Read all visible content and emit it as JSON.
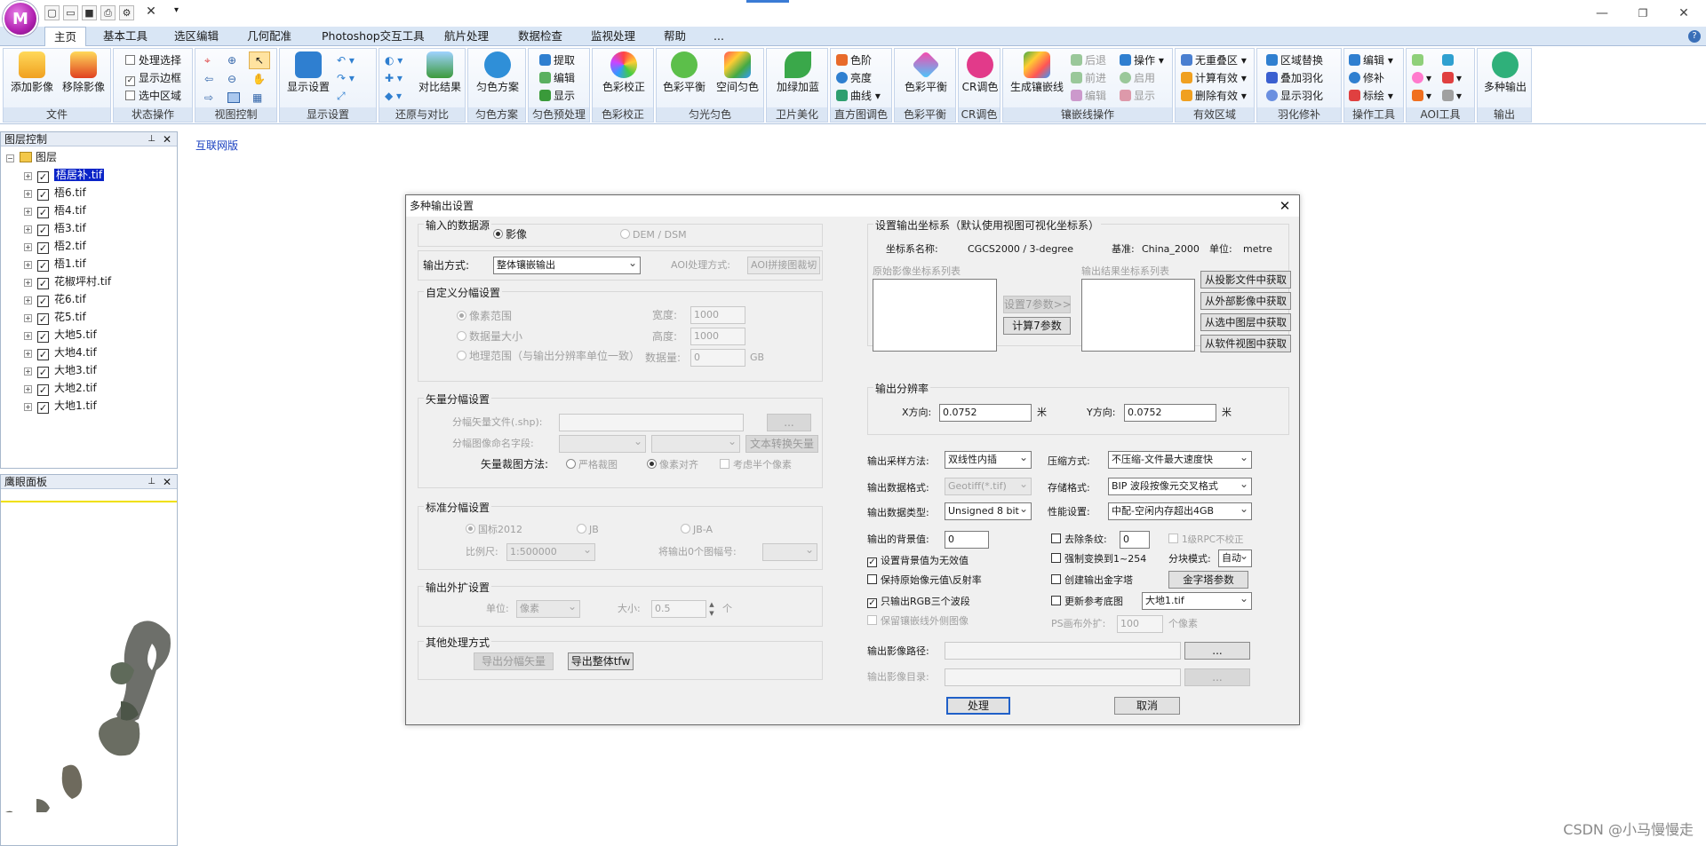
{
  "app": {
    "logo_text": "M",
    "top_indicator_color": "#3a7bd5",
    "window_controls": [
      "—",
      "❐",
      "✕"
    ],
    "ribbon_help": "?"
  },
  "tabs": [
    "主页",
    "基本工具",
    "选区编辑",
    "几何配准",
    "Photoshop交互工具",
    "航片处理",
    "数据检查",
    "监视处理",
    "帮助",
    "..."
  ],
  "ribbon": {
    "file": {
      "title": "文件",
      "add": "添加影像",
      "remove": "移除影像"
    },
    "state": {
      "title": "状态操作",
      "sel": "处理选择",
      "border": "显示边框",
      "region": "选中区域"
    },
    "view": {
      "title": "视图控制"
    },
    "display": {
      "title": "显示设置",
      "btn": "显示设置"
    },
    "restore": {
      "title": "还原与对比",
      "btn": "对比结果"
    },
    "uniform": {
      "title": "匀色方案",
      "btn": "匀色方案"
    },
    "preview": {
      "title": "匀色预处理",
      "extract": "提取",
      "edit": "编辑",
      "show": "显示"
    },
    "color": {
      "title": "色彩校正",
      "btn": "色彩校正"
    },
    "light": {
      "title": "匀光匀色",
      "balance": "色彩平衡",
      "spatial": "空间匀色"
    },
    "sat": {
      "title": "卫片美化",
      "btn": "加绿加蓝"
    },
    "hist": {
      "title": "直方图调色",
      "levels": "色阶",
      "bright": "亮度",
      "curve": "曲线"
    },
    "cb": {
      "title": "色彩平衡",
      "btn": "色彩平衡"
    },
    "cr": {
      "title": "CR调色",
      "btn": "CR调色"
    },
    "seam": {
      "title": "镶嵌线操作",
      "gen": "生成镶嵌线",
      "back": "后退",
      "fwd": "前进",
      "edit": "编辑",
      "op": "操作",
      "enable": "启用",
      "show": "显示"
    },
    "valid": {
      "title": "有效区域",
      "nooverlap": "无重叠区",
      "calc": "计算有效",
      "del": "删除有效"
    },
    "feather": {
      "title": "羽化修补",
      "replace": "区域替换",
      "overlay": "叠加羽化",
      "show": "显示羽化"
    },
    "optool": {
      "title": "操作工具",
      "edit": "编辑",
      "patch": "修补",
      "mark": "标绘"
    },
    "aoi": {
      "title": "AOI工具"
    },
    "output": {
      "title": "输出",
      "btn": "多种输出"
    }
  },
  "layer_panel": {
    "title": "图层控制",
    "root": "图层",
    "items": [
      "梧居补.tif",
      "梧6.tif",
      "梧4.tif",
      "梧3.tif",
      "梧2.tif",
      "梧1.tif",
      "花椒坪村.tif",
      "花6.tif",
      "花5.tif",
      "大地5.tif",
      "大地4.tif",
      "大地3.tif",
      "大地2.tif",
      "大地1.tif"
    ]
  },
  "eye_panel": {
    "title": "鹰眼面板"
  },
  "map": {
    "link": "互联网版"
  },
  "dialog": {
    "title": "多种输出设置",
    "input_source": {
      "title": "输入的数据源",
      "image": "影像",
      "dem": "DEM / DSM"
    },
    "output_mode": {
      "label": "输出方式:",
      "value": "整体镶嵌输出",
      "aoi_label": "AOI处理方式:",
      "aoi_value": "AOI拼接图裁切"
    },
    "custom_tile": {
      "title": "自定义分幅设置",
      "pixel": "像素范围",
      "count": "数据量大小",
      "geo": "地理范围（与输出分辨率单位一致）",
      "width_label": "宽度:",
      "width": "1000",
      "height_label": "高度:",
      "height": "1000",
      "size_label": "数据量:",
      "size": "0",
      "size_unit": "GB"
    },
    "vector_tile": {
      "title": "矢量分幅设置",
      "file_label": "分幅矢量文件(.shp):",
      "browse": "...",
      "name_label": "分幅图像命名字段:",
      "convert": "文本转换矢量",
      "method_label": "矢量裁图方法:",
      "strict": "严格裁图",
      "align": "像素对齐",
      "half": "考虑半个像素"
    },
    "standard_tile": {
      "title": "标准分幅设置",
      "gb": "国标2012",
      "jb": "JB",
      "jba": "JB-A",
      "scale_label": "比例尺:",
      "scale": "1:500000",
      "output_label": "将输出0个图幅号:"
    },
    "expand": {
      "title": "输出外扩设置",
      "unit_label": "单位:",
      "unit": "像素",
      "size_label": "大小:",
      "size": "0.5",
      "size_unit": "个"
    },
    "other": {
      "title": "其他处理方式",
      "export_vec": "导出分幅矢量",
      "export_tfw": "导出整体tfw"
    },
    "crs": {
      "title": "设置输出坐标系（默认使用视图可视化坐标系）",
      "name_label": "坐标系名称:",
      "name": "CGCS2000 / 3-degree",
      "datum_label": "基准:",
      "datum": "China_2000",
      "unit_label": "单位:",
      "unit": "metre",
      "src_list": "原始影像坐标系列表",
      "dst_list": "输出结果坐标系列表",
      "set7": "设置7参数>>",
      "calc7": "计算7参数",
      "from_proj": "从投影文件中获取",
      "from_ext": "从外部影像中获取",
      "from_layer": "从选中图层中获取",
      "from_view": "从软件视图中获取"
    },
    "resolution": {
      "title": "输出分辨率",
      "x_label": "X方向:",
      "x": "0.0752",
      "y_label": "Y方向:",
      "y": "0.0752",
      "unit": "米"
    },
    "opts": {
      "resample_label": "输出采样方法:",
      "resample": "双线性内插",
      "compress_label": "压缩方式:",
      "compress": "不压缩-文件最大速度快",
      "format_label": "输出数据格式:",
      "format": "Geotiff(*.tif)",
      "store_label": "存储格式:",
      "store": "BIP 波段按像元交叉格式",
      "dtype_label": "输出数据类型:",
      "dtype": "Unsigned 8 bit",
      "perf_label": "性能设置:",
      "perf": "中配-空闲内存超出4GB",
      "bg_label": "输出的背景值:",
      "bg": "0",
      "stripe_label": "去除条纹:",
      "stripe": "0",
      "rpc": "1级RPC不校正",
      "bg_invalid": "设置背景值为无效值",
      "force": "强制变换到1~254",
      "block_label": "分块模式:",
      "block": "自动",
      "keep_refl": "保持原始像元值\\反射率",
      "pyramid": "创建输出金字塔",
      "pyramid_btn": "金字塔参数",
      "rgb_only": "只输出RGB三个波段",
      "update_base": "更新参考底图",
      "base": "大地1.tif",
      "keep_outer": "保留镶嵌线外侧图像",
      "ps_label": "PS画布外扩:",
      "ps": "100",
      "ps_unit": "个像素"
    },
    "path": {
      "img_label": "输出影像路径:",
      "dir_label": "输出影像目录:",
      "browse": "..."
    },
    "ok": "处理",
    "cancel": "取消"
  },
  "watermark": "CSDN @小马慢慢走"
}
